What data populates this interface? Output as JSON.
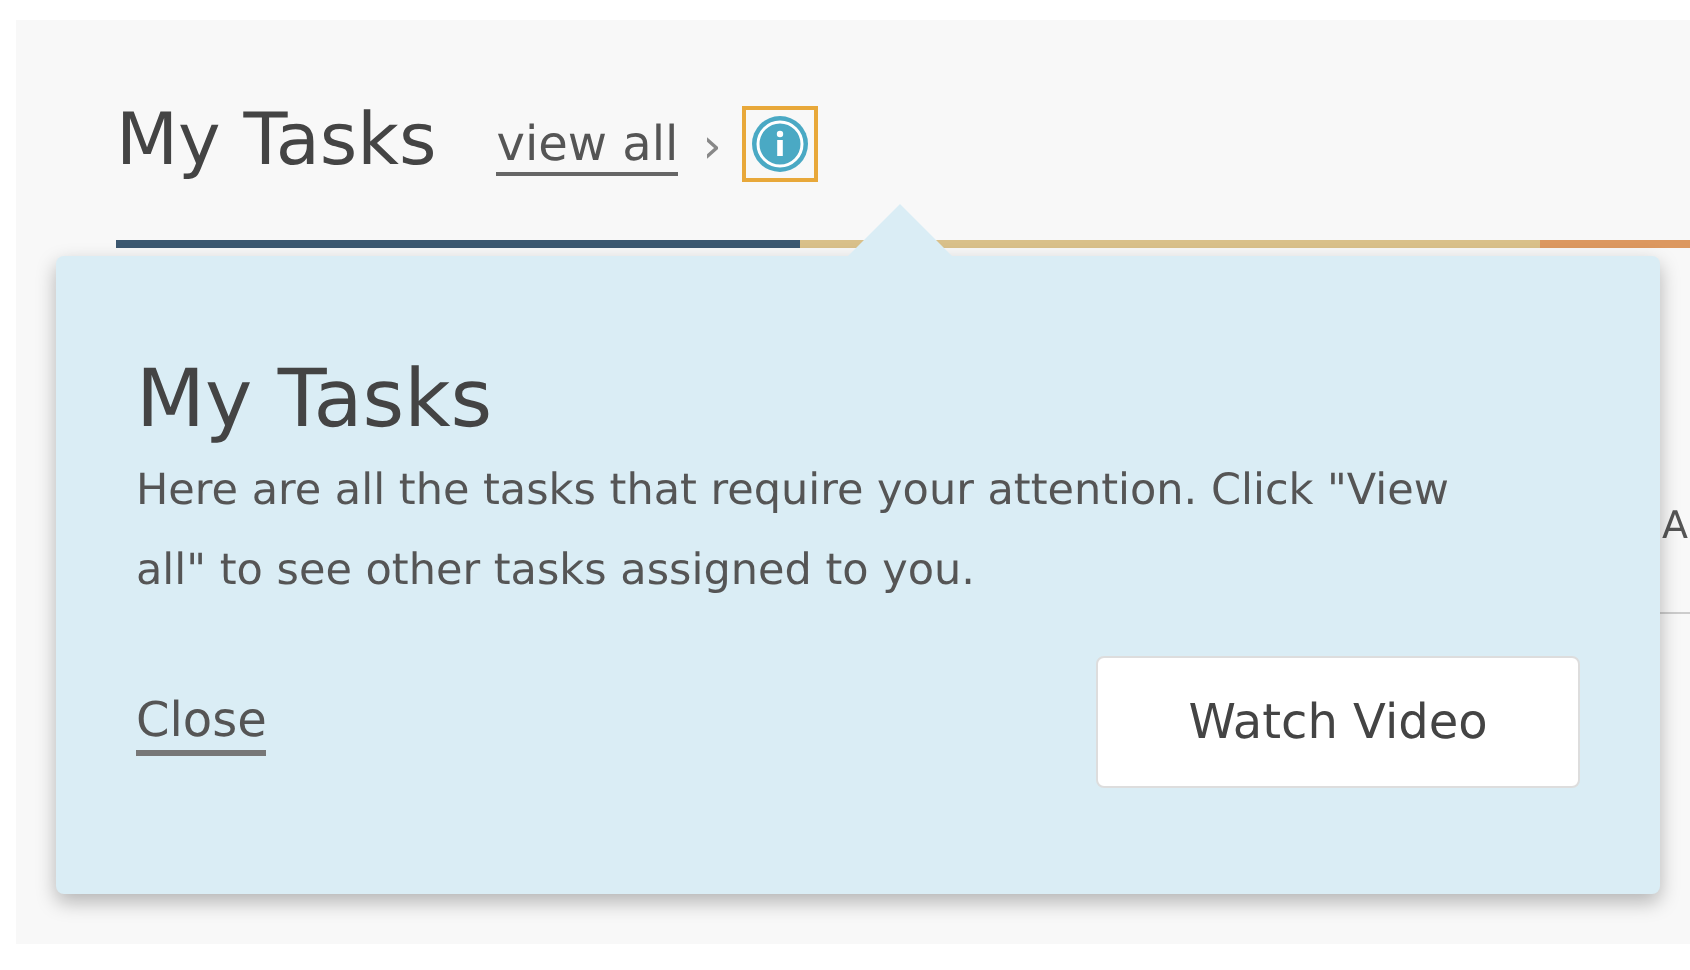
{
  "header": {
    "title": "My Tasks",
    "link": "view all",
    "chevron": "›"
  },
  "behind": {
    "column_text": "A"
  },
  "popover": {
    "title": "My Tasks",
    "body": "Here are all the tasks that require your attention. Click \"View all\" to see other tasks assigned to you.",
    "close": "Close",
    "button": "Watch Video"
  }
}
